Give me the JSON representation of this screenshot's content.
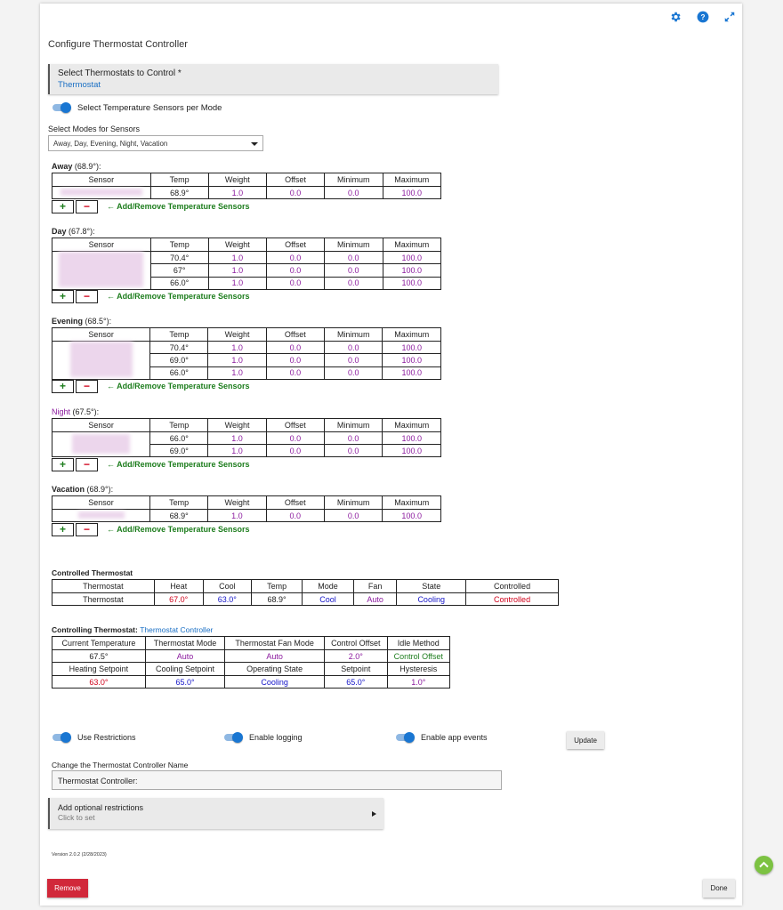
{
  "page_title": "Configure Thermostat Controller",
  "icons": {
    "settings": "gear-icon",
    "help": "help-icon",
    "expand": "expand-icon",
    "scroll_top": "chevron-up-icon"
  },
  "colors": {
    "accent": "#1976d2",
    "link": "#1a6fc4",
    "value_purple": "#8b1a9e",
    "heat_red": "#d0021b",
    "cool_blue": "#1414c8",
    "green": "#1d7d1d",
    "remove": "#d1283a",
    "fab": "#7cc242"
  },
  "thermostat_select": {
    "label": "Select Thermostats to Control *",
    "value": "Thermostat"
  },
  "sensors_per_mode_toggle": {
    "label": "Select Temperature Sensors per Mode",
    "on": true
  },
  "modes_select": {
    "label": "Select Modes for Sensors",
    "value": "Away, Day, Evening, Night, Vacation"
  },
  "sensor_table_headers": [
    "Sensor",
    "Temp",
    "Weight",
    "Offset",
    "Minimum",
    "Maximum"
  ],
  "add_remove_label": "← Add/Remove Temperature Sensors",
  "plus_label": "+",
  "minus_label": "−",
  "modes": [
    {
      "name": "Away",
      "temp": " (68.9°):",
      "rows": [
        [
          "68.9°",
          "1.0",
          "0.0",
          "0.0",
          "100.0"
        ]
      ]
    },
    {
      "name": "Day",
      "temp": " (67.8°):",
      "rows": [
        [
          "70.4°",
          "1.0",
          "0.0",
          "0.0",
          "100.0"
        ],
        [
          "67°",
          "1.0",
          "0.0",
          "0.0",
          "100.0"
        ],
        [
          "66.0°",
          "1.0",
          "0.0",
          "0.0",
          "100.0"
        ]
      ]
    },
    {
      "name": "Evening",
      "temp": " (68.5°):",
      "rows": [
        [
          "70.4°",
          "1.0",
          "0.0",
          "0.0",
          "100.0"
        ],
        [
          "69.0°",
          "1.0",
          "0.0",
          "0.0",
          "100.0"
        ],
        [
          "66.0°",
          "1.0",
          "0.0",
          "0.0",
          "100.0"
        ]
      ]
    },
    {
      "name": "Night",
      "temp": " (67.5°):",
      "rows": [
        [
          "66.0°",
          "1.0",
          "0.0",
          "0.0",
          "100.0"
        ],
        [
          "69.0°",
          "1.0",
          "0.0",
          "0.0",
          "100.0"
        ]
      ]
    },
    {
      "name": "Vacation",
      "temp": " (68.9°):",
      "rows": [
        [
          "68.9°",
          "1.0",
          "0.0",
          "0.0",
          "100.0"
        ]
      ]
    }
  ],
  "controlled": {
    "title": "Controlled Thermostat",
    "headers": [
      "Thermostat",
      "Heat",
      "Cool",
      "Temp",
      "Mode",
      "Fan",
      "State",
      "Controlled"
    ],
    "values": [
      "Thermostat",
      "67.0°",
      "63.0°",
      "68.9°",
      "Cool",
      "Auto",
      "Cooling",
      "Controlled"
    ]
  },
  "controlling": {
    "title": "Controlling Thermostat:",
    "link": "Thermostat Controller",
    "headers1": [
      "Current Temperature",
      "Thermostat Mode",
      "Thermostat Fan Mode",
      "Control Offset",
      "Idle Method"
    ],
    "values1": [
      "67.5°",
      "Auto",
      "Auto",
      "2.0°",
      "Control Offset"
    ],
    "headers2": [
      "Heating Setpoint",
      "Cooling Setpoint",
      "Operating State",
      "Setpoint",
      "Hysteresis"
    ],
    "values2": [
      "63.0°",
      "65.0°",
      "Cooling",
      "65.0°",
      "1.0°"
    ]
  },
  "options": {
    "use_restrictions": "Use Restrictions",
    "enable_logging": "Enable logging",
    "enable_app_events": "Enable app events",
    "update": "Update"
  },
  "name_field": {
    "label": "Change the Thermostat Controller Name",
    "value": "Thermostat Controller:"
  },
  "restrictions": {
    "label": "Add optional restrictions",
    "sub": "Click to set"
  },
  "version": "Version 2.0.2 (2/28/2023)",
  "remove_label": "Remove",
  "done_label": "Done"
}
